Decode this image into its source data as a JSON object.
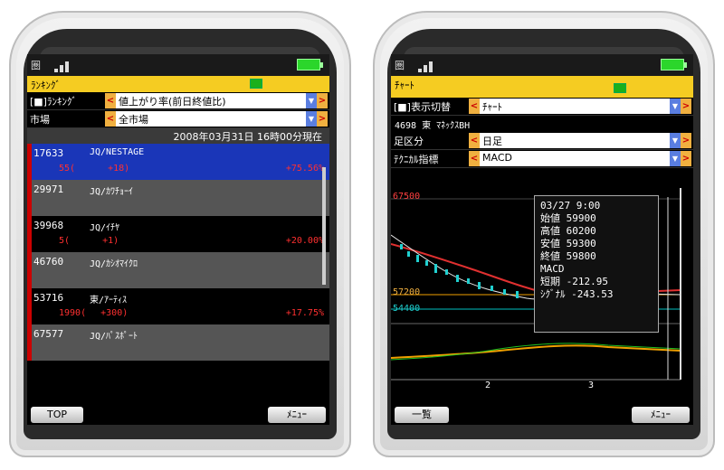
{
  "left": {
    "antenna": "圏",
    "title": "ﾗﾝｷﾝｸﾞ",
    "filter_rows": [
      {
        "label": "[■]ﾗﾝｷﾝｸﾞ",
        "value": "値上がり率(前日終値比)"
      },
      {
        "label": "市場",
        "value": "全市場"
      }
    ],
    "date_text": "2008年03月31日 16時00分現在",
    "items": [
      {
        "rank": "1",
        "code": "7633",
        "name": "JQ/NESTAGE",
        "price": "55(",
        "diff": "+18)",
        "change": "+75.56%"
      },
      {
        "rank": "2",
        "code": "9971",
        "name": "JQ/ｶﾜﾁｮｰｲ",
        "price": "",
        "diff": "",
        "change": ""
      },
      {
        "rank": "3",
        "code": "9968",
        "name": "JQ/ｲﾁﾔ",
        "price": "5(",
        "diff": "+1)",
        "change": "+20.00%"
      },
      {
        "rank": "4",
        "code": "6760",
        "name": "JQ/ｶｼｵﾏｲｸﾛ",
        "price": "",
        "diff": "",
        "change": ""
      },
      {
        "rank": "5",
        "code": "3716",
        "name": "東/ｱｰﾃｨｽ",
        "price": "1990(",
        "diff": "+300)",
        "change": "+17.75%"
      },
      {
        "rank": "6",
        "code": "7577",
        "name": "JQ/ﾊﾟｽﾎﾟｰﾄ",
        "price": "",
        "diff": "",
        "change": ""
      }
    ],
    "softkey_left": "TOP",
    "softkey_right": "ﾒﾆｭｰ"
  },
  "right": {
    "antenna": "圏",
    "title": "ﾁｬｰﾄ",
    "rows": [
      {
        "label": "[■]表示切替",
        "value": "ﾁｬｰﾄ"
      },
      {
        "label": "足区分",
        "value": "日足"
      },
      {
        "label": "ﾃｸﾆｶﾙ指標",
        "value": "MACD"
      }
    ],
    "stock_line": "4698 東 ﾏﾈｯｸｽBH",
    "price_labels": [
      "67500",
      "57200",
      "54400"
    ],
    "x_ticks": [
      "2",
      "3"
    ],
    "popup": {
      "date": "03/27 9:00",
      "rows": [
        {
          "label": "始値",
          "value": "59900"
        },
        {
          "label": "高値",
          "value": "60200"
        },
        {
          "label": "安値",
          "value": "59300"
        },
        {
          "label": "終値",
          "value": "59800"
        }
      ],
      "macd_title": "MACD",
      "macd_rows": [
        {
          "label": "短期",
          "value": "-212.95"
        },
        {
          "label": "ｼｸﾞﾅﾙ",
          "value": "-243.53"
        }
      ]
    },
    "softkey_left": "一覧",
    "softkey_right": "ﾒﾆｭｰ"
  }
}
